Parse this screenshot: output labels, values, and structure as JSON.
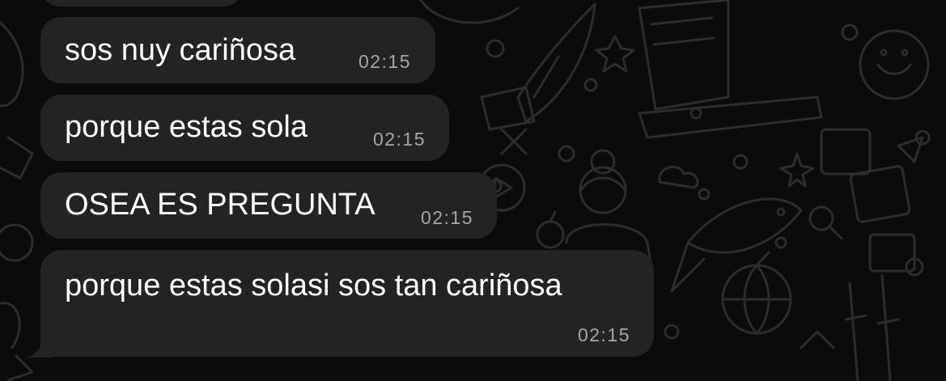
{
  "chat": {
    "messages": [
      {
        "text": "sos nuy cariñosa",
        "time": "02:15"
      },
      {
        "text": "porque estas sola",
        "time": "02:15"
      },
      {
        "text": "OSEA ES PREGUNTA",
        "time": "02:15"
      },
      {
        "text": "porque estas solasi sos tan cariñosa",
        "time": "02:15"
      }
    ]
  },
  "colors": {
    "background": "#0b0b0b",
    "bubble": "#222323",
    "message_text": "#ffffff",
    "timestamp": "#a6a6a6",
    "doodle_pattern": "#2c2c2c"
  }
}
